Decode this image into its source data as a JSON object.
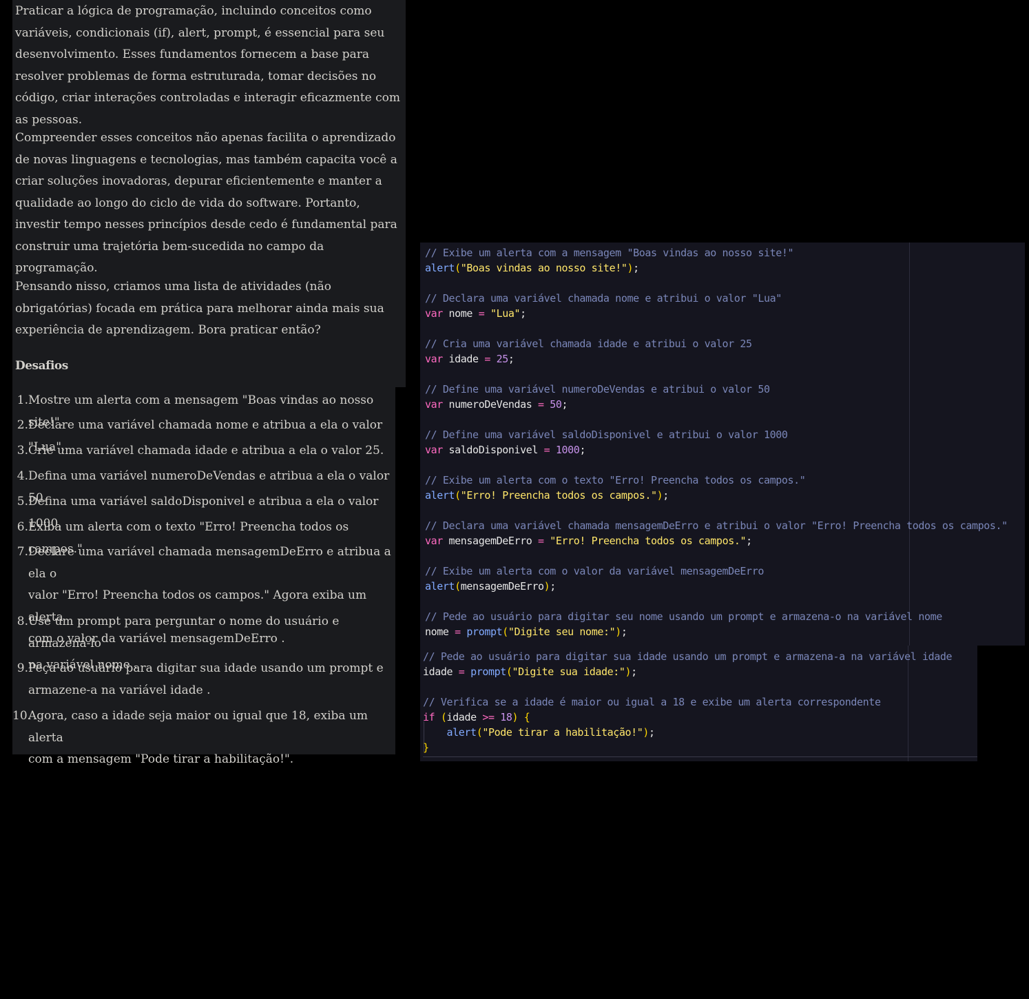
{
  "intro": {
    "p1": "Praticar a lógica de programação, incluindo conceitos como variáveis, condicionais (if), alert, prompt, é essencial para seu desenvolvimento. Esses fundamentos fornecem a base para resolver problemas de forma estruturada, tomar decisões no código, criar interações controladas e interagir eficazmente com as pessoas.",
    "p2": "Compreender esses conceitos não apenas facilita o aprendizado de novas linguagens e tecnologias, mas também capacita você a criar soluções inovadoras, depurar eficientemente e manter a qualidade ao longo do ciclo de vida do software. Portanto, investir tempo nesses princípios desde cedo é fundamental para construir uma trajetória bem-sucedida no campo da programação.",
    "p3": "Pensando nisso, criamos uma lista de atividades (não obrigatórias) focada em prática para melhorar ainda mais sua experiência de aprendizagem. Bora praticar então?",
    "heading": "Desafios"
  },
  "challenges": [
    {
      "n": "1.",
      "a": "Mostre um alerta com a mensagem \"Boas vindas ao nosso site!\"."
    },
    {
      "n": "2.",
      "a": "Declare uma variável chamada ",
      "code": "nome",
      "b": " e atribua a ela o valor \"Lua\"."
    },
    {
      "n": "3.",
      "a": "Crie uma variável chamada ",
      "code": "idade",
      "b": " e atribua a ela o valor 25."
    },
    {
      "n": "4.",
      "a": "Defina uma variável ",
      "code": "numeroDeVendas",
      "b": " e atribua a ela o valor 50."
    },
    {
      "n": "5.",
      "a": "Defina uma variável ",
      "code": "saldoDisponivel",
      "b": " e atribua a ela o valor 1000."
    },
    {
      "n": "6.",
      "a": "Exiba um alerta com o texto \"Erro! Preencha todos os campos.\""
    },
    {
      "n": "7.",
      "a": "Declare uma variável chamada ",
      "code": "mensagemDeErro",
      "b": " e atribua a ela o",
      "c": "valor \"Erro! Preencha todos os campos.\" Agora exiba um alerta",
      "d": "com o valor da variável ",
      "code2": "mensagemDeErro",
      "e": "."
    },
    {
      "n": "8.",
      "a": "Use um prompt para perguntar o nome do usuário e armazená-lo",
      "c": "na variável ",
      "code2": "nome",
      "e": "."
    },
    {
      "n": "9.",
      "a": "Peça ao usuário para digitar sua idade usando um prompt e",
      "c": "armazene-a na variável ",
      "code2": "idade",
      "e": "."
    },
    {
      "n": "10.",
      "a": "Agora, caso a idade seja maior ou igual que 18, exiba um alerta",
      "c": "com a mensagem \"Pode tirar a habilitação!\"."
    }
  ],
  "code1": [
    [
      [
        "cm",
        "// Exibe um alerta com a mensagem \"Boas vindas ao nosso site!\""
      ]
    ],
    [
      [
        "fn",
        "alert"
      ],
      [
        "br",
        "("
      ],
      [
        "str",
        "\"Boas vindas ao nosso site!\""
      ],
      [
        "br",
        ")"
      ],
      [
        "pn",
        ";"
      ]
    ],
    [],
    [
      [
        "cm",
        "// Declara uma variável chamada nome e atribui o valor \"Lua\""
      ]
    ],
    [
      [
        "kw",
        "var"
      ],
      [
        "id",
        " nome "
      ],
      [
        "op",
        "="
      ],
      [
        "str",
        " \"Lua\""
      ],
      [
        "pn",
        ";"
      ]
    ],
    [],
    [
      [
        "cm",
        "// Cria uma variável chamada idade e atribui o valor 25"
      ]
    ],
    [
      [
        "kw",
        "var"
      ],
      [
        "id",
        " idade "
      ],
      [
        "op",
        "="
      ],
      [
        "num-lit",
        " 25"
      ],
      [
        "pn",
        ";"
      ]
    ],
    [],
    [
      [
        "cm",
        "// Define uma variável numeroDeVendas e atribui o valor 50"
      ]
    ],
    [
      [
        "kw",
        "var"
      ],
      [
        "id",
        " numeroDeVendas "
      ],
      [
        "op",
        "="
      ],
      [
        "num-lit",
        " 50"
      ],
      [
        "pn",
        ";"
      ]
    ],
    [],
    [
      [
        "cm",
        "// Define uma variável saldoDisponivel e atribui o valor 1000"
      ]
    ],
    [
      [
        "kw",
        "var"
      ],
      [
        "id",
        " saldoDisponivel "
      ],
      [
        "op",
        "="
      ],
      [
        "num-lit",
        " 1000"
      ],
      [
        "pn",
        ";"
      ]
    ],
    [],
    [
      [
        "cm",
        "// Exibe um alerta com o texto \"Erro! Preencha todos os campos.\""
      ]
    ],
    [
      [
        "fn",
        "alert"
      ],
      [
        "br",
        "("
      ],
      [
        "str",
        "\"Erro! Preencha todos os campos.\""
      ],
      [
        "br",
        ")"
      ],
      [
        "pn",
        ";"
      ]
    ],
    [],
    [
      [
        "cm",
        "// Declara uma variável chamada mensagemDeErro e atribui o valor \"Erro! Preencha todos os campos.\""
      ]
    ],
    [
      [
        "kw",
        "var"
      ],
      [
        "id",
        " mensagemDeErro "
      ],
      [
        "op",
        "="
      ],
      [
        "str",
        " \"Erro! Preencha todos os campos.\""
      ],
      [
        "pn",
        ";"
      ]
    ],
    [],
    [
      [
        "cm",
        "// Exibe um alerta com o valor da variável mensagemDeErro"
      ]
    ],
    [
      [
        "fn",
        "alert"
      ],
      [
        "br",
        "("
      ],
      [
        "id",
        "mensagemDeErro"
      ],
      [
        "br",
        ")"
      ],
      [
        "pn",
        ";"
      ]
    ],
    [],
    [
      [
        "cm",
        "// Pede ao usuário para digitar seu nome usando um prompt e armazena-o na variável nome"
      ]
    ],
    [
      [
        "id",
        "nome "
      ],
      [
        "op",
        "="
      ],
      [
        "fn",
        " prompt"
      ],
      [
        "br",
        "("
      ],
      [
        "str",
        "\"Digite seu nome:\""
      ],
      [
        "br",
        ")"
      ],
      [
        "pn",
        ";"
      ]
    ]
  ],
  "code2": [
    [
      [
        "cm",
        "// Pede ao usuário para digitar sua idade usando um prompt e armazena-a na variável idade"
      ]
    ],
    [
      [
        "id",
        "idade "
      ],
      [
        "op",
        "="
      ],
      [
        "fn",
        " prompt"
      ],
      [
        "br",
        "("
      ],
      [
        "str",
        "\"Digite sua idade:\""
      ],
      [
        "br",
        ")"
      ],
      [
        "pn",
        ";"
      ]
    ],
    [],
    [
      [
        "cm",
        "// Verifica se a idade é maior ou igual a 18 e exibe um alerta correspondente"
      ]
    ],
    [
      [
        "kw",
        "if"
      ],
      [
        "id",
        " "
      ],
      [
        "br",
        "("
      ],
      [
        "id",
        "idade "
      ],
      [
        "op",
        ">="
      ],
      [
        "num-lit",
        " 18"
      ],
      [
        "br",
        ")"
      ],
      [
        "id",
        " "
      ],
      [
        "brace",
        "{"
      ]
    ],
    [
      [
        "id",
        "    "
      ],
      [
        "fn",
        "alert"
      ],
      [
        "br",
        "("
      ],
      [
        "str",
        "\"Pode tirar a habilitação!\""
      ],
      [
        "br",
        ")"
      ],
      [
        "pn",
        ";"
      ]
    ],
    [
      [
        "brace",
        "}"
      ]
    ]
  ]
}
